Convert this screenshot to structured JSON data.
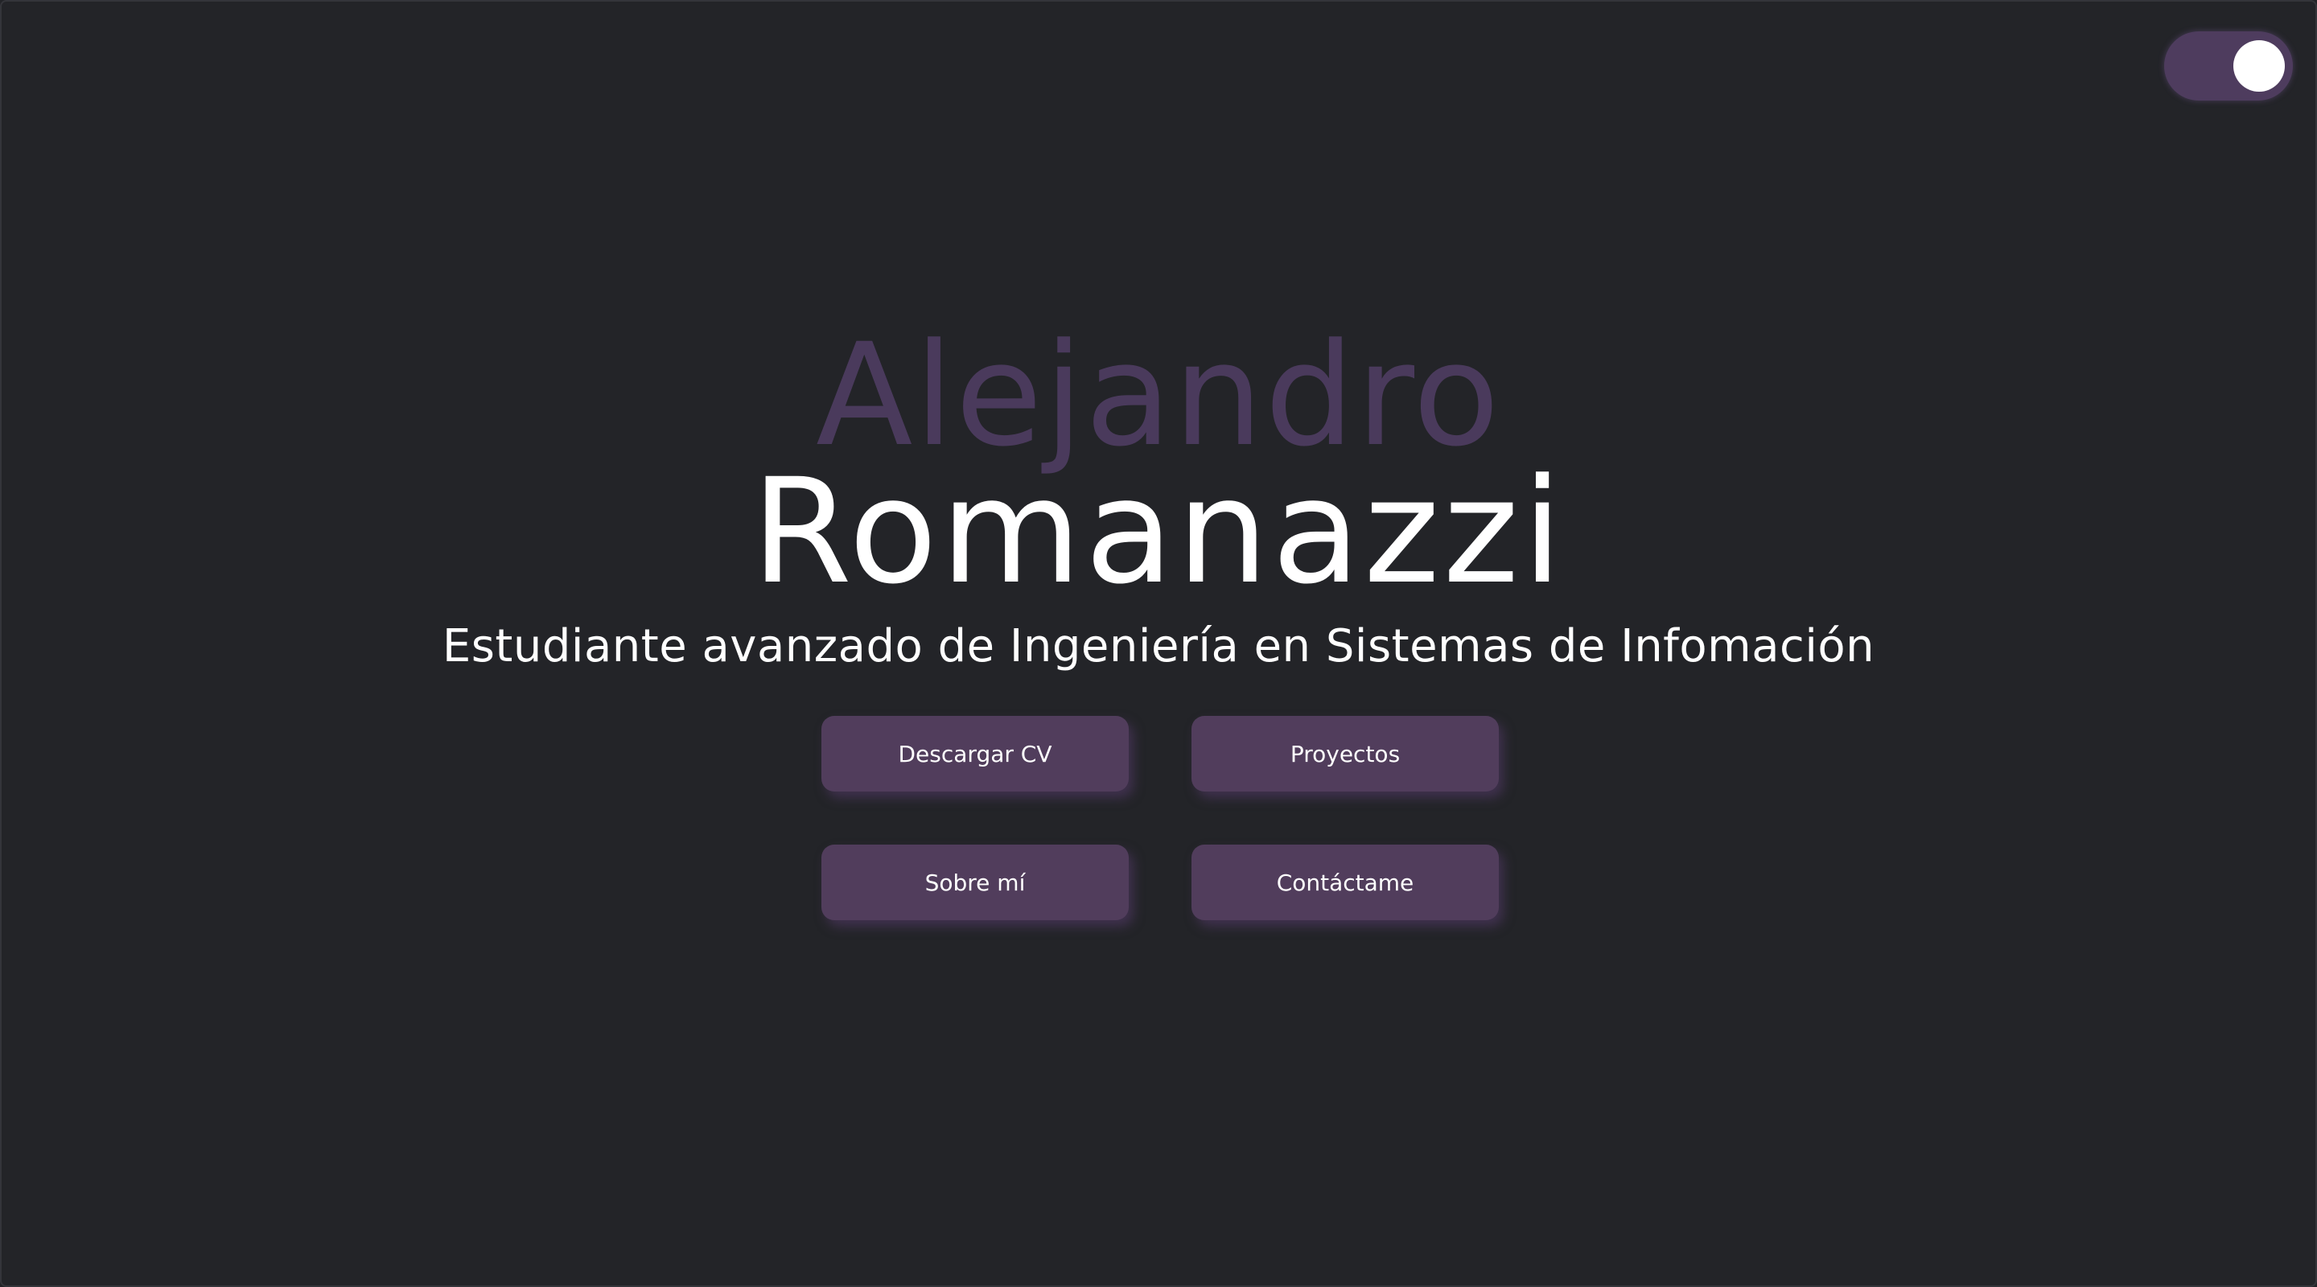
{
  "theme_toggle": {
    "state": "on",
    "accent": "#4e3c5e"
  },
  "hero": {
    "first_name": "Alejandro",
    "last_name": "Romanazzi",
    "subtitle": "Estudiante avanzado de Ingeniería en Sistemas de Infomación"
  },
  "buttons": {
    "download_cv": "Descargar CV",
    "projects": "Proyectos",
    "about": "Sobre mí",
    "contact": "Contáctame"
  },
  "colors": {
    "background": "#232428",
    "first_name": "#4a3a5c",
    "button": "#513d5c",
    "text": "#ffffff"
  }
}
